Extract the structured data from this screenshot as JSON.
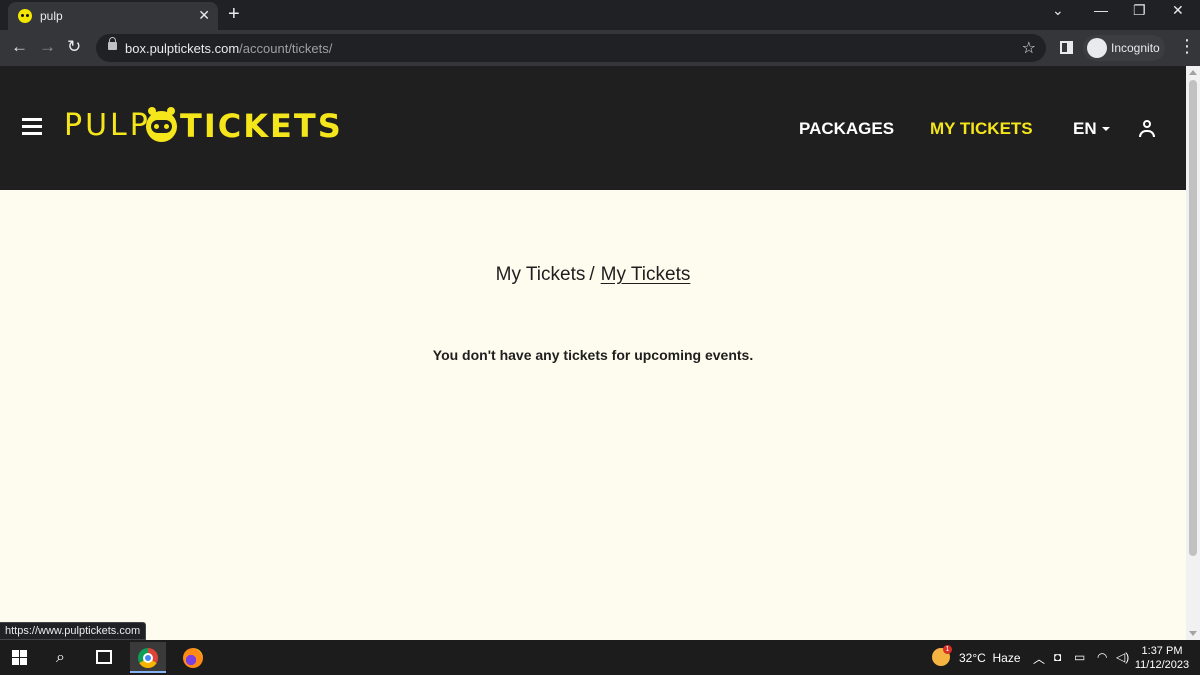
{
  "browser": {
    "tab_title": "pulp",
    "tab_close": "✕",
    "new_tab": "+",
    "url_host": "box.pulptickets.com",
    "url_path": "/account/tickets/",
    "incognito_label": "Incognito",
    "status_url": "https://www.pulptickets.com"
  },
  "site": {
    "brand_colors": {
      "accent": "#f5e51b",
      "header_bg": "#1f1f1f",
      "page_bg": "#fefcef"
    },
    "logo_text_left": "PULP",
    "logo_text_right": "TICKETS",
    "nav": [
      {
        "label": "PACKAGES",
        "active": false
      },
      {
        "label": "MY TICKETS",
        "active": true
      }
    ],
    "language": "EN"
  },
  "main": {
    "breadcrumb": {
      "parent": "My Tickets",
      "separator": "/",
      "current": "My Tickets"
    },
    "empty_message": "You don't have any tickets for upcoming events."
  },
  "taskbar": {
    "weather_temp": "32°C",
    "weather_desc": "Haze",
    "weather_badge": "1",
    "time": "1:37 PM",
    "date": "11/12/2023"
  }
}
